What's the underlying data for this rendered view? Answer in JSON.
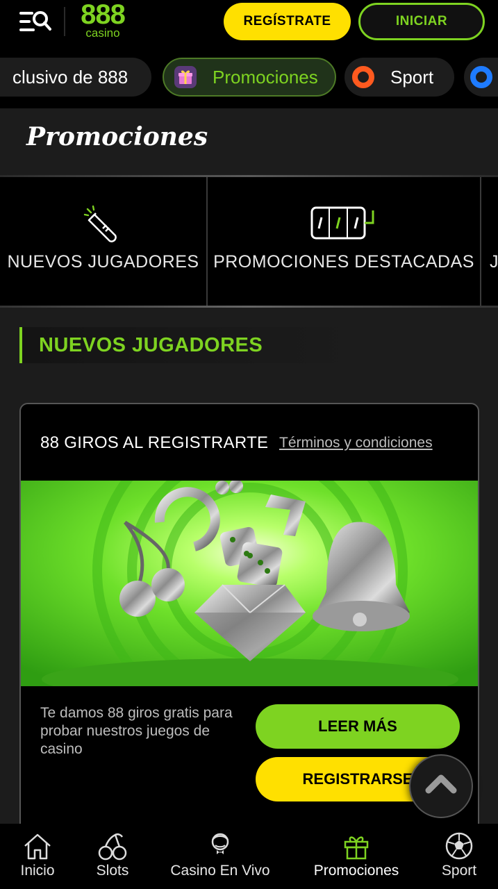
{
  "header": {
    "logo_number": "888",
    "logo_word": "casino",
    "register_label": "REGÍSTRATE",
    "login_label": "INICIAR"
  },
  "chips": [
    {
      "label": "clusivo de 888",
      "icon": "none"
    },
    {
      "label": "Promociones",
      "icon": "gift-icon",
      "active": true
    },
    {
      "label": "Sport",
      "icon": "sport-ring-icon"
    },
    {
      "label": "",
      "icon": "blue-ring-icon"
    }
  ],
  "page": {
    "title": "Promociones"
  },
  "categories": [
    {
      "label": "NUEVOS JUGADORES",
      "icon": "champagne-icon"
    },
    {
      "label": "PROMOCIONES DESTACADAS",
      "icon": "slot-reels-icon"
    },
    {
      "label": "J",
      "icon": "none"
    }
  ],
  "section": {
    "title": "NUEVOS JUGADORES"
  },
  "promo_card": {
    "title": "88 GIROS AL REGISTRARTE",
    "terms_label": "Términos y condiciones",
    "description": "Te damos 88 giros gratis para probar nuestros juegos de casino",
    "read_more_label": "LEER MÁS",
    "signup_label": "REGISTRARSE"
  },
  "bottom_nav": [
    {
      "label": "Inicio",
      "icon": "home-icon"
    },
    {
      "label": "Slots",
      "icon": "cherries-icon"
    },
    {
      "label": "Casino En Vivo",
      "icon": "dealer-icon"
    },
    {
      "label": "Promociones",
      "icon": "gift-icon",
      "active": true
    },
    {
      "label": "Sport",
      "icon": "soccer-ball-icon"
    }
  ],
  "colors": {
    "brand_green": "#7ed321",
    "brand_yellow": "#ffe000",
    "background": "#1c1c1c",
    "header_bg": "#000000"
  }
}
